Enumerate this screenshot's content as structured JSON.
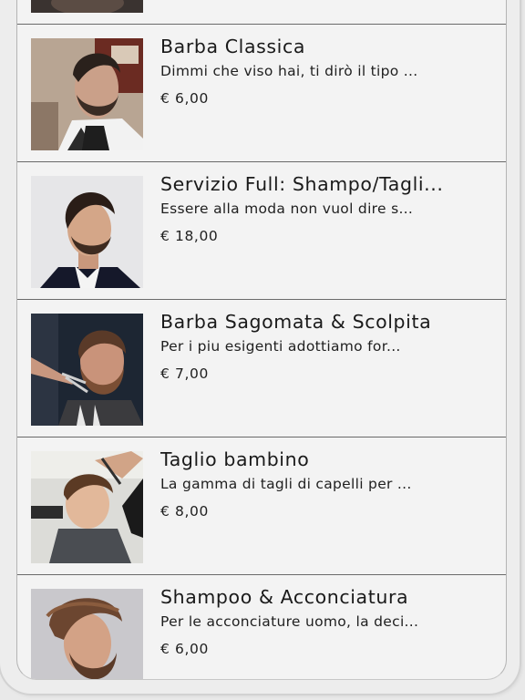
{
  "services": [
    {
      "title": "",
      "description": "",
      "price": "",
      "image": "partial-previous-thumb"
    },
    {
      "title": "Barba Classica",
      "description": "Dimmi che viso hai, ti dirò il tipo ...",
      "price": "€ 6,00",
      "image": "man-beard-barbershop-photo"
    },
    {
      "title": "Servizio Full: Shampo/Tagli...",
      "description": "Essere alla moda non vuol dire s...",
      "price": "€ 18,00",
      "image": "man-pompadour-haircut-photo"
    },
    {
      "title": "Barba Sagomata & Scolpita",
      "description": "Per i piu esigenti  adottiamo for...",
      "price": "€ 7,00",
      "image": "beard-trimming-scissors-photo"
    },
    {
      "title": "Taglio bambino",
      "description": "La gamma di tagli di capelli per ...",
      "price": "€ 8,00",
      "image": "child-haircut-photo"
    },
    {
      "title": "Shampoo & Acconciatura",
      "description": "Per le acconciature uomo, la deci...",
      "price": "€ 6,00",
      "image": "man-styled-hair-photo"
    }
  ]
}
